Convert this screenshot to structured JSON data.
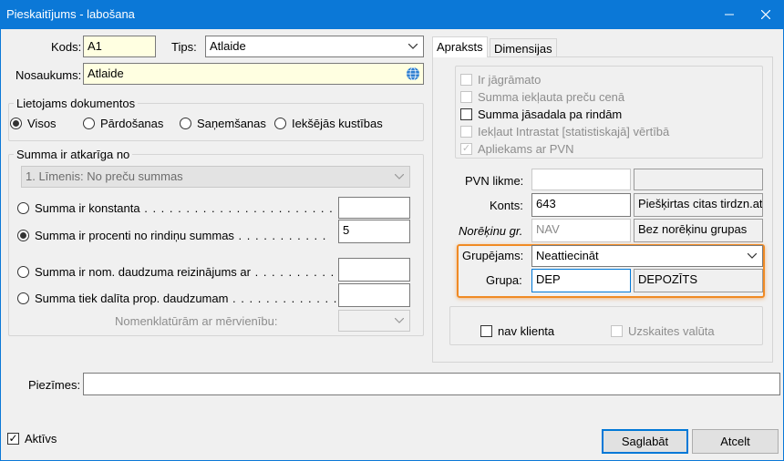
{
  "window": {
    "title": "Pieskaitījums - labošana"
  },
  "fields": {
    "kods_label": "Kods:",
    "kods_value": "A1",
    "tips_label": "Tips:",
    "tips_value": "Atlaide",
    "nosaukums_label": "Nosaukums:",
    "nosaukums_value": "Atlaide"
  },
  "lietojams": {
    "title": "Lietojams dokumentos",
    "options": [
      "Visos",
      "Pārdošanas",
      "Saņemšanas",
      "Iekšējās kustības"
    ],
    "selected": "Visos"
  },
  "summa": {
    "title": "Summa ir atkarīga no",
    "level_value": "1. Līmenis: No preču summas",
    "opt_konstanta": "Summa ir konstanta",
    "opt_procenti": "Summa ir procenti no rindiņu summas",
    "procenti_value": "5",
    "opt_nom": "Summa ir nom. daudzuma reizinājums ar",
    "opt_dalita": "Summa tiek dalīta prop. daudzumam",
    "nomenklaturam_label": "Nomenklatūrām ar mērvienību:",
    "selected": "Summa ir procenti no rindiņu summas"
  },
  "tabs": [
    "Apraksts",
    "Dimensijas"
  ],
  "apraksts": {
    "checks": [
      {
        "label": "Ir jāgrāmato",
        "checked": false,
        "enabled": false
      },
      {
        "label": "Summa iekļauta preču cenā",
        "checked": false,
        "enabled": false
      },
      {
        "label": "Summa jāsadala pa rindām",
        "checked": false,
        "enabled": true
      },
      {
        "label": "Iekļaut Intrastat [statistiskajā] vērtībā",
        "checked": false,
        "enabled": false
      },
      {
        "label": "Apliekams ar PVN",
        "checked": true,
        "enabled": false
      }
    ],
    "pvn_label": "PVN likme:",
    "pvn_value": "",
    "pvn_desc": "",
    "konts_label": "Konts:",
    "konts_value": "643",
    "konts_desc": "Piešķirtas citas tirdzn.at",
    "noreckinu_label": "Norēķinu gr.",
    "noreckinu_value": "NAV",
    "noreckinu_desc": "Bez norēķinu grupas",
    "grupejams_label": "Grupējams:",
    "grupejams_value": "Neattiecināt",
    "grupa_label": "Grupa:",
    "grupa_value": "DEP",
    "grupa_desc": "DEPOZĪTS",
    "nav_klienta": "nav klienta",
    "uzskaites_valuta": "Uzskaites valūta"
  },
  "piezimes_label": "Piezīmes:",
  "piezimes_value": "",
  "aktivs_label": "Aktīvs",
  "buttons": {
    "save": "Saglabāt",
    "cancel": "Atcelt"
  },
  "colors": {
    "titlebar": "#0b78d7",
    "highlight": "#f08a24",
    "yellow_field": "#ffffe1"
  }
}
